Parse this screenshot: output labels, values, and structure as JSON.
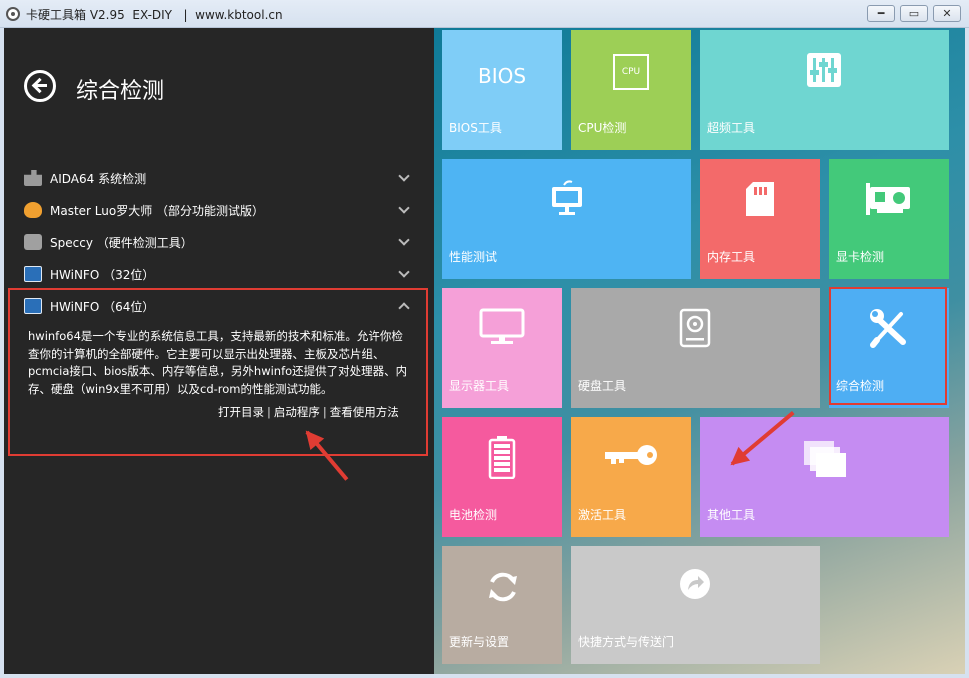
{
  "window": {
    "title": "卡硬工具箱 V2.95  EX-DIY   |  www.kbtool.cn",
    "minimize_label": "━",
    "maximize_label": "▭",
    "close_label": "✕"
  },
  "left": {
    "page_title": "综合检测",
    "items": [
      {
        "label": "AIDA64 系统检测"
      },
      {
        "label": "Master Luo罗大师 （部分功能测试版）"
      },
      {
        "label": "Speccy （硬件检测工具）"
      },
      {
        "label": "HWiNFO （32位）"
      },
      {
        "label": "HWiNFO （64位）"
      }
    ],
    "description": "hwinfo64是一个专业的系统信息工具，支持最新的技术和标准。允许你检查你的计算机的全部硬件。它主要可以显示出处理器、主板及芯片组、pcmcia接口、bios版本、内存等信息，另外hwinfo还提供了对处理器、内存、硬盘（win9x里不可用）以及cd-rom的性能测试功能。",
    "links": {
      "open_dir": "打开目录",
      "launch": "启动程序",
      "help": "查看使用方法",
      "sep": "|"
    }
  },
  "tiles": [
    {
      "label": "BIOS工具",
      "icon_text": "BIOS",
      "color": "#7fcdf7"
    },
    {
      "label": "CPU检测",
      "icon_text": "CPU",
      "color": "#9dcf56"
    },
    {
      "label": "超频工具",
      "color": "#6fd6d1"
    },
    {
      "label": "性能测试",
      "color": "#4eb4f3"
    },
    {
      "label": "内存工具",
      "color": "#f36a6a"
    },
    {
      "label": "显卡检测",
      "color": "#43c97a"
    },
    {
      "label": "显示器工具",
      "color": "#f5a0d8"
    },
    {
      "label": "硬盘工具",
      "color": "#a9a9a9"
    },
    {
      "label": "综合检测",
      "color": "#4eaef3"
    },
    {
      "label": "电池检测",
      "color": "#f55a9e"
    },
    {
      "label": "激活工具",
      "color": "#f7a94a"
    },
    {
      "label": "其他工具",
      "color": "#c58cf2"
    },
    {
      "label": "更新与设置",
      "color": "#b8aca1"
    },
    {
      "label": "快捷方式与传送门",
      "color": "#c9c9c9"
    }
  ]
}
